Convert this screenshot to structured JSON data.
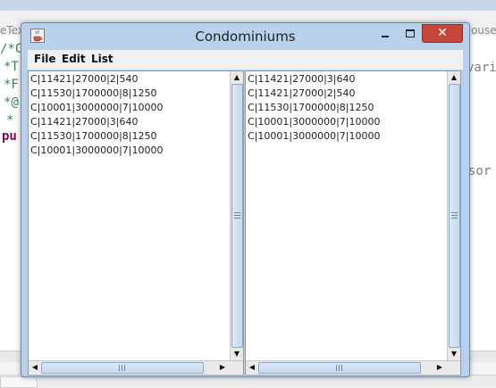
{
  "ide": {
    "tab_left": "eTex",
    "tab_right": "House",
    "code_fragments": [
      "/*C",
      "*T",
      "*F",
      "*@",
      "*",
      "pu",
      "vari",
      "sor"
    ]
  },
  "window": {
    "title": "Condominiums",
    "close_glyph": "✕",
    "menu": [
      "File",
      "Edit",
      "List"
    ]
  },
  "left_list": [
    "C|11421|27000|2|540",
    "C|11530|1700000|8|1250",
    "C|10001|3000000|7|10000",
    "C|11421|27000|3|640",
    "C|11530|1700000|8|1250",
    "C|10001|3000000|7|10000"
  ],
  "right_list": [
    "C|11421|27000|3|640",
    "C|11421|27000|2|540",
    "C|11530|1700000|8|1250",
    "C|10001|3000000|7|10000",
    "C|10001|3000000|7|10000"
  ],
  "icons": {
    "app": "java-cup-icon",
    "minimize": "minimize-icon",
    "maximize": "maximize-icon",
    "close": "close-icon"
  },
  "colors": {
    "title_bar": "#b9d1ea",
    "close_button": "#c7463c",
    "comment": "#3f7f5f",
    "keyword": "#7f0055"
  }
}
